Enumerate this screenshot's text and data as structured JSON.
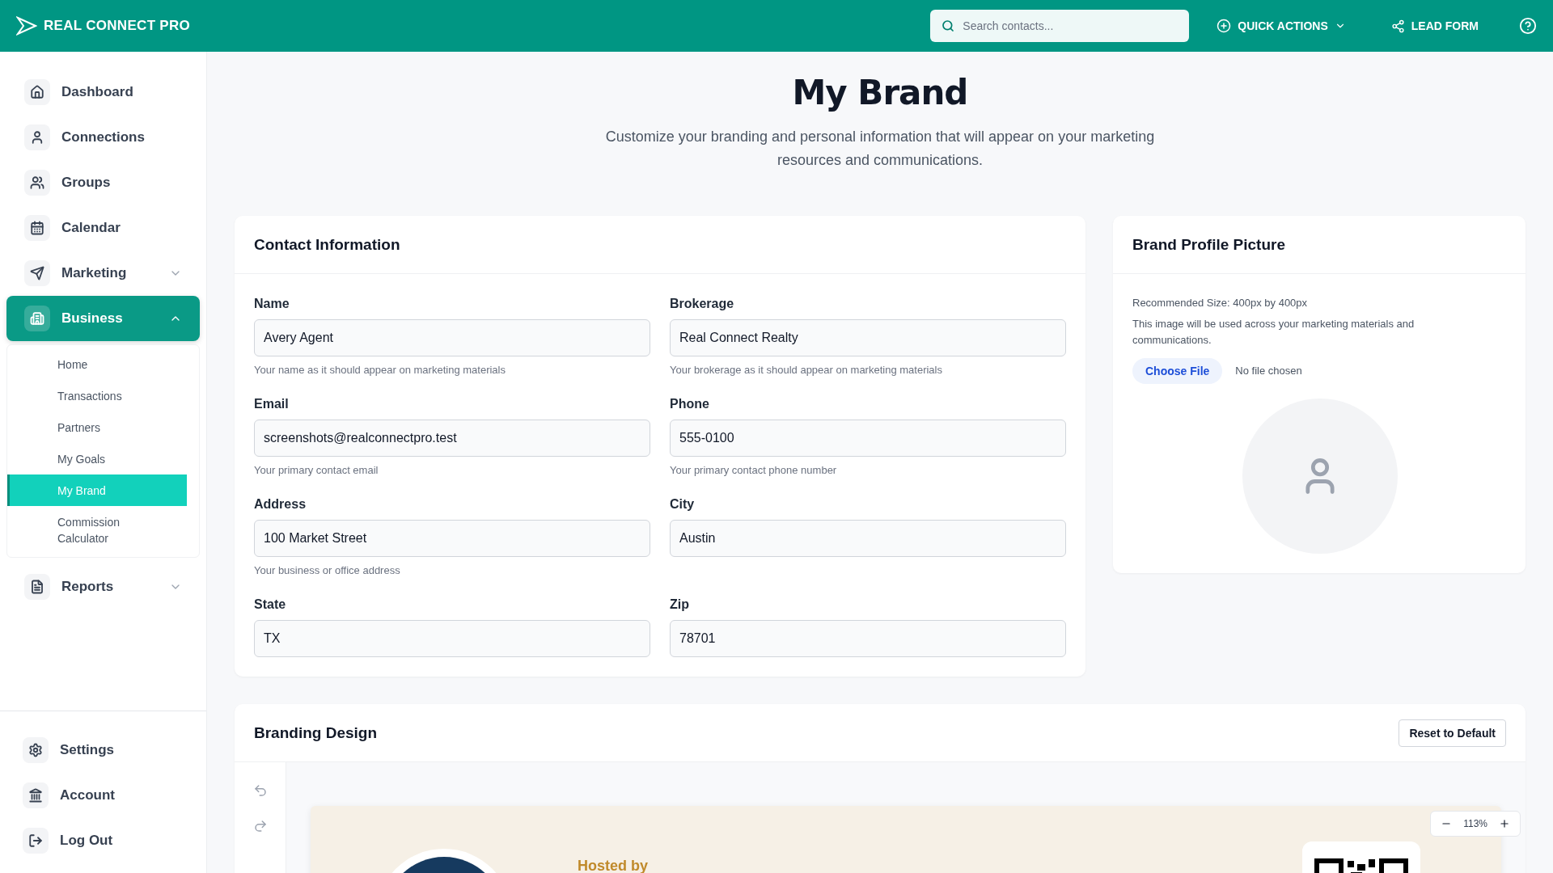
{
  "header": {
    "brand": "REAL CONNECT PRO",
    "search": {
      "placeholder": "Search contacts..."
    },
    "quick_actions": "QUICK ACTIONS",
    "lead_form": "LEAD FORM"
  },
  "sidebar": {
    "items": [
      {
        "kind": "link",
        "label": "Dashboard",
        "selected": false
      },
      {
        "kind": "link",
        "label": "Connections",
        "selected": false
      },
      {
        "kind": "link",
        "label": "Groups",
        "selected": false
      },
      {
        "kind": "link",
        "label": "Calendar",
        "selected": false
      },
      {
        "kind": "group",
        "label": "Marketing",
        "selected": false,
        "expanded": false
      },
      {
        "kind": "group",
        "label": "Business",
        "selected": true,
        "expanded": true,
        "children": [
          {
            "label": "Home",
            "selected": false
          },
          {
            "label": "Transactions",
            "selected": false
          },
          {
            "label": "Partners",
            "selected": false
          },
          {
            "label": "My Goals",
            "selected": false
          },
          {
            "label": "My Brand",
            "selected": true
          },
          {
            "label": "Commission Calculator",
            "selected": false
          }
        ]
      },
      {
        "kind": "group",
        "label": "Reports",
        "selected": false,
        "expanded": false
      }
    ],
    "bottom_items": [
      {
        "label": "Settings"
      },
      {
        "label": "Account"
      },
      {
        "label": "Log Out"
      }
    ]
  },
  "page": {
    "title": "My Brand",
    "subtitle": "Customize your branding and personal information that will appear on your marketing resources and communications."
  },
  "contact_card": {
    "title": "Contact Information",
    "fields": [
      {
        "label": "Name",
        "value": "Avery Agent",
        "hint": "Your name as it should appear on marketing materials"
      },
      {
        "label": "Brokerage",
        "value": "Real Connect Realty",
        "hint": "Your brokerage as it should appear on marketing materials"
      },
      {
        "label": "Email",
        "value": "screenshots@realconnectpro.test",
        "hint": "Your primary contact email"
      },
      {
        "label": "Phone",
        "value": "555-0100",
        "hint": "Your primary contact phone number"
      },
      {
        "label": "Address",
        "value": "100 Market Street",
        "hint": "Your business or office address"
      },
      {
        "label": "City",
        "value": "Austin"
      },
      {
        "label": "State",
        "value": "TX"
      },
      {
        "label": "Zip",
        "value": "78701"
      }
    ]
  },
  "profile_card": {
    "title": "Brand Profile Picture",
    "size_note": "Recommended Size: 400px by 400px",
    "description": "This image will be used across your marketing materials and communications.",
    "choose_file": "Choose File",
    "file_status": "No file chosen"
  },
  "branding": {
    "title": "Branding Design",
    "reset_button": "Reset to Default",
    "preview": {
      "hosted_label": "Hosted by"
    },
    "zoom": "113%"
  }
}
